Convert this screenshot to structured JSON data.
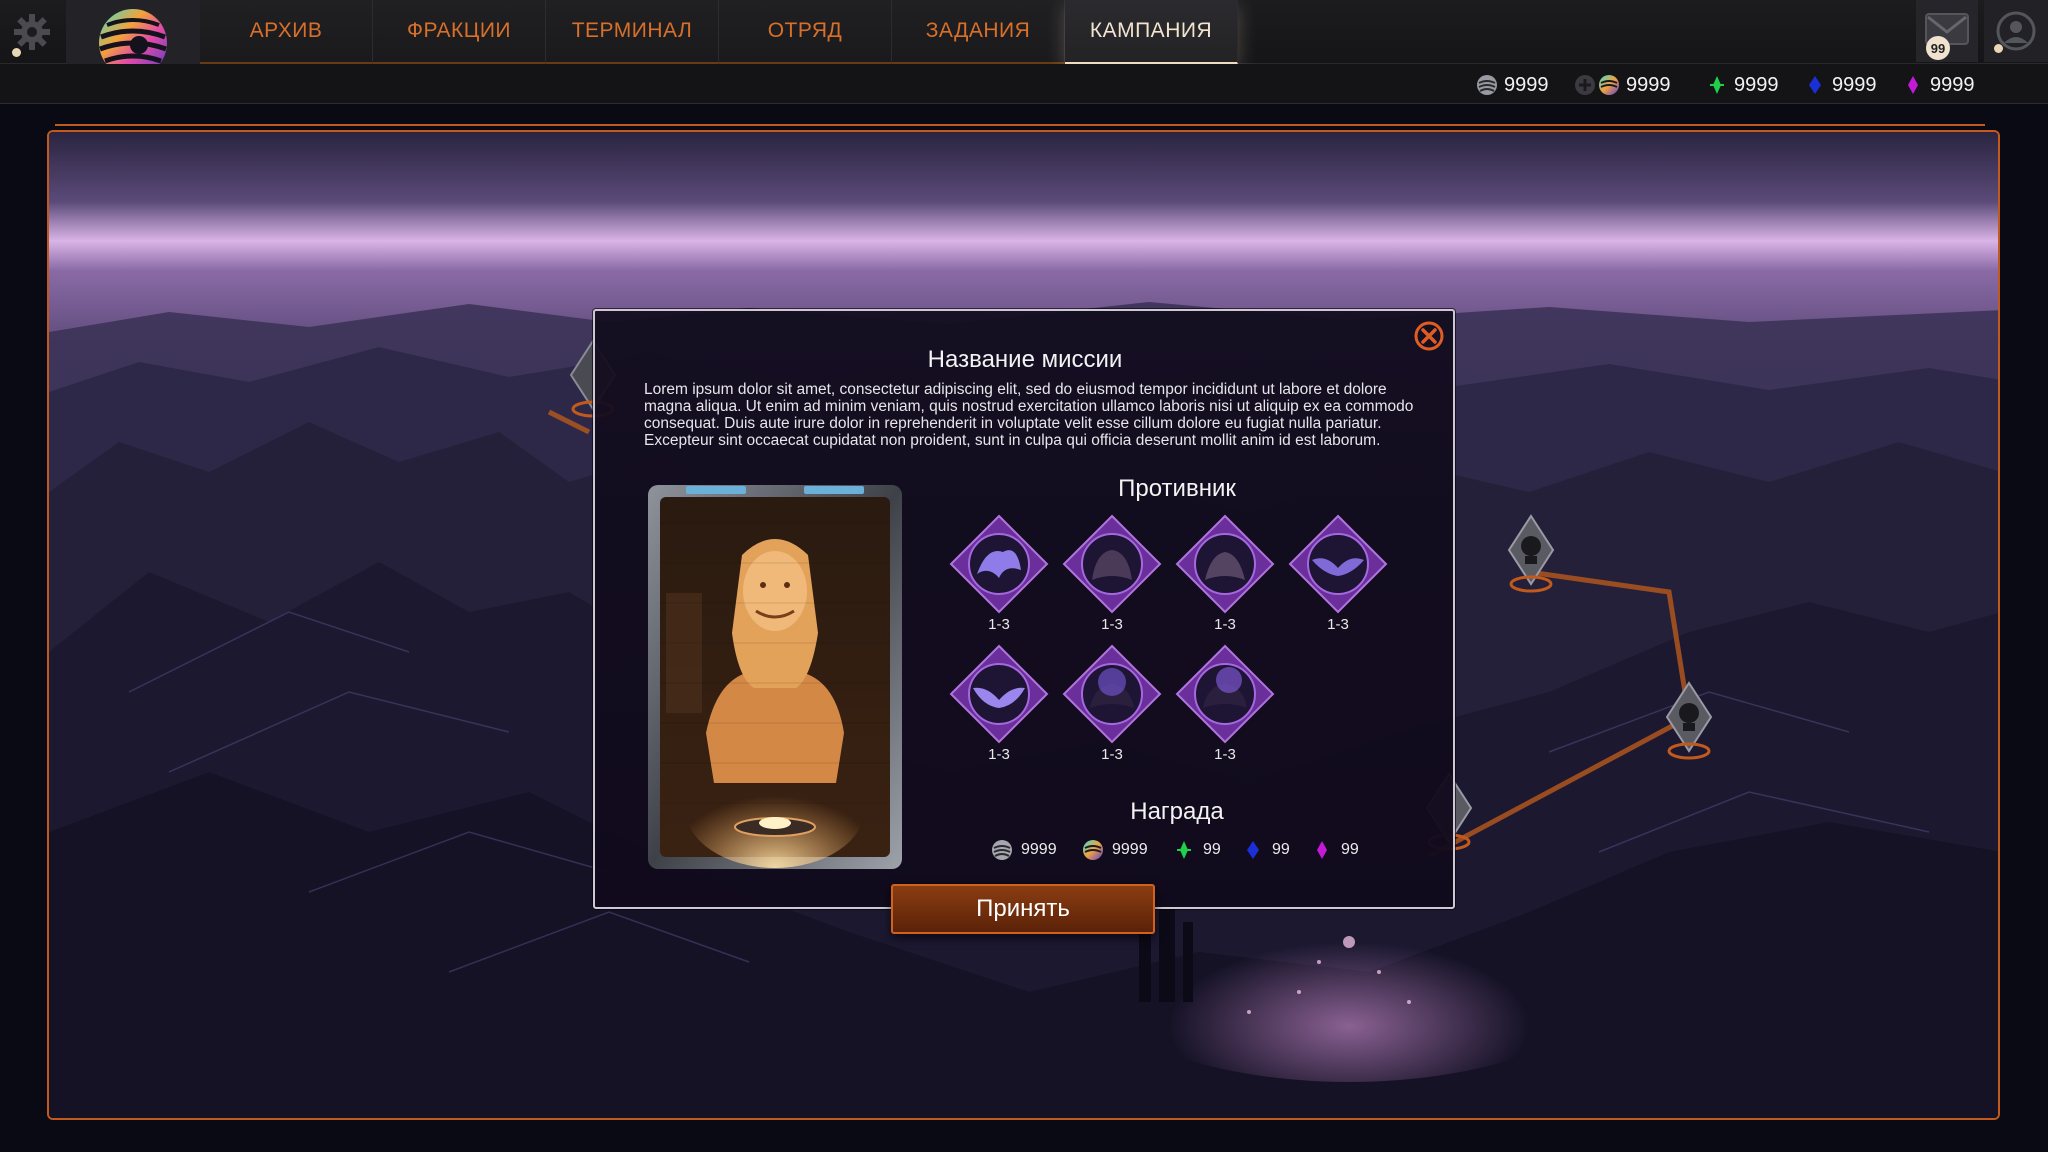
{
  "nav": {
    "tabs": [
      {
        "label": "АРХИВ",
        "active": false
      },
      {
        "label": "ФРАКЦИИ",
        "active": false
      },
      {
        "label": "ТЕРМИНАЛ",
        "active": false
      },
      {
        "label": "ОТРЯД",
        "active": false
      },
      {
        "label": "ЗАДАНИЯ",
        "active": false
      },
      {
        "label": "КАМПАНИЯ",
        "active": true
      }
    ],
    "mail_badge": "99"
  },
  "resources": [
    {
      "icon": "metal-coin-icon",
      "value": "9999"
    },
    {
      "icon": "rainbow-coin-icon",
      "value": "9999"
    },
    {
      "icon": "green-crystal-icon",
      "value": "9999"
    },
    {
      "icon": "blue-crystal-icon",
      "value": "9999"
    },
    {
      "icon": "purple-crystal-icon",
      "value": "9999"
    }
  ],
  "mission": {
    "title": "Название миссии",
    "description": "Lorem ipsum dolor sit amet, consectetur adipiscing elit, sed do eiusmod tempor incididunt ut labore et dolore magna aliqua. Ut enim ad minim veniam, quis nostrud exercitation ullamco laboris nisi ut aliquip ex ea commodo consequat. Duis aute irure dolor in reprehenderit in voluptate velit esse cillum dolore eu fugiat nulla pariatur. Excepteur sint occaecat cupidatat non proident, sunt in culpa qui officia deserunt mollit anim id est laborum.",
    "enemy_title": "Противник",
    "enemies": [
      {
        "level": "1-3"
      },
      {
        "level": "1-3"
      },
      {
        "level": "1-3"
      },
      {
        "level": "1-3"
      },
      {
        "level": "1-3"
      },
      {
        "level": "1-3"
      },
      {
        "level": "1-3"
      }
    ],
    "reward_title": "Награда",
    "rewards": [
      {
        "icon": "metal-coin-icon",
        "value": "9999"
      },
      {
        "icon": "rainbow-coin-icon",
        "value": "9999"
      },
      {
        "icon": "green-crystal-icon",
        "value": "99"
      },
      {
        "icon": "blue-crystal-icon",
        "value": "99"
      },
      {
        "icon": "purple-crystal-icon",
        "value": "99"
      }
    ],
    "accept_label": "Принять"
  },
  "colors": {
    "accent_orange": "#d8702a",
    "frame_orange": "#c15a1c",
    "enemy_purple": "#8b3fc4"
  }
}
